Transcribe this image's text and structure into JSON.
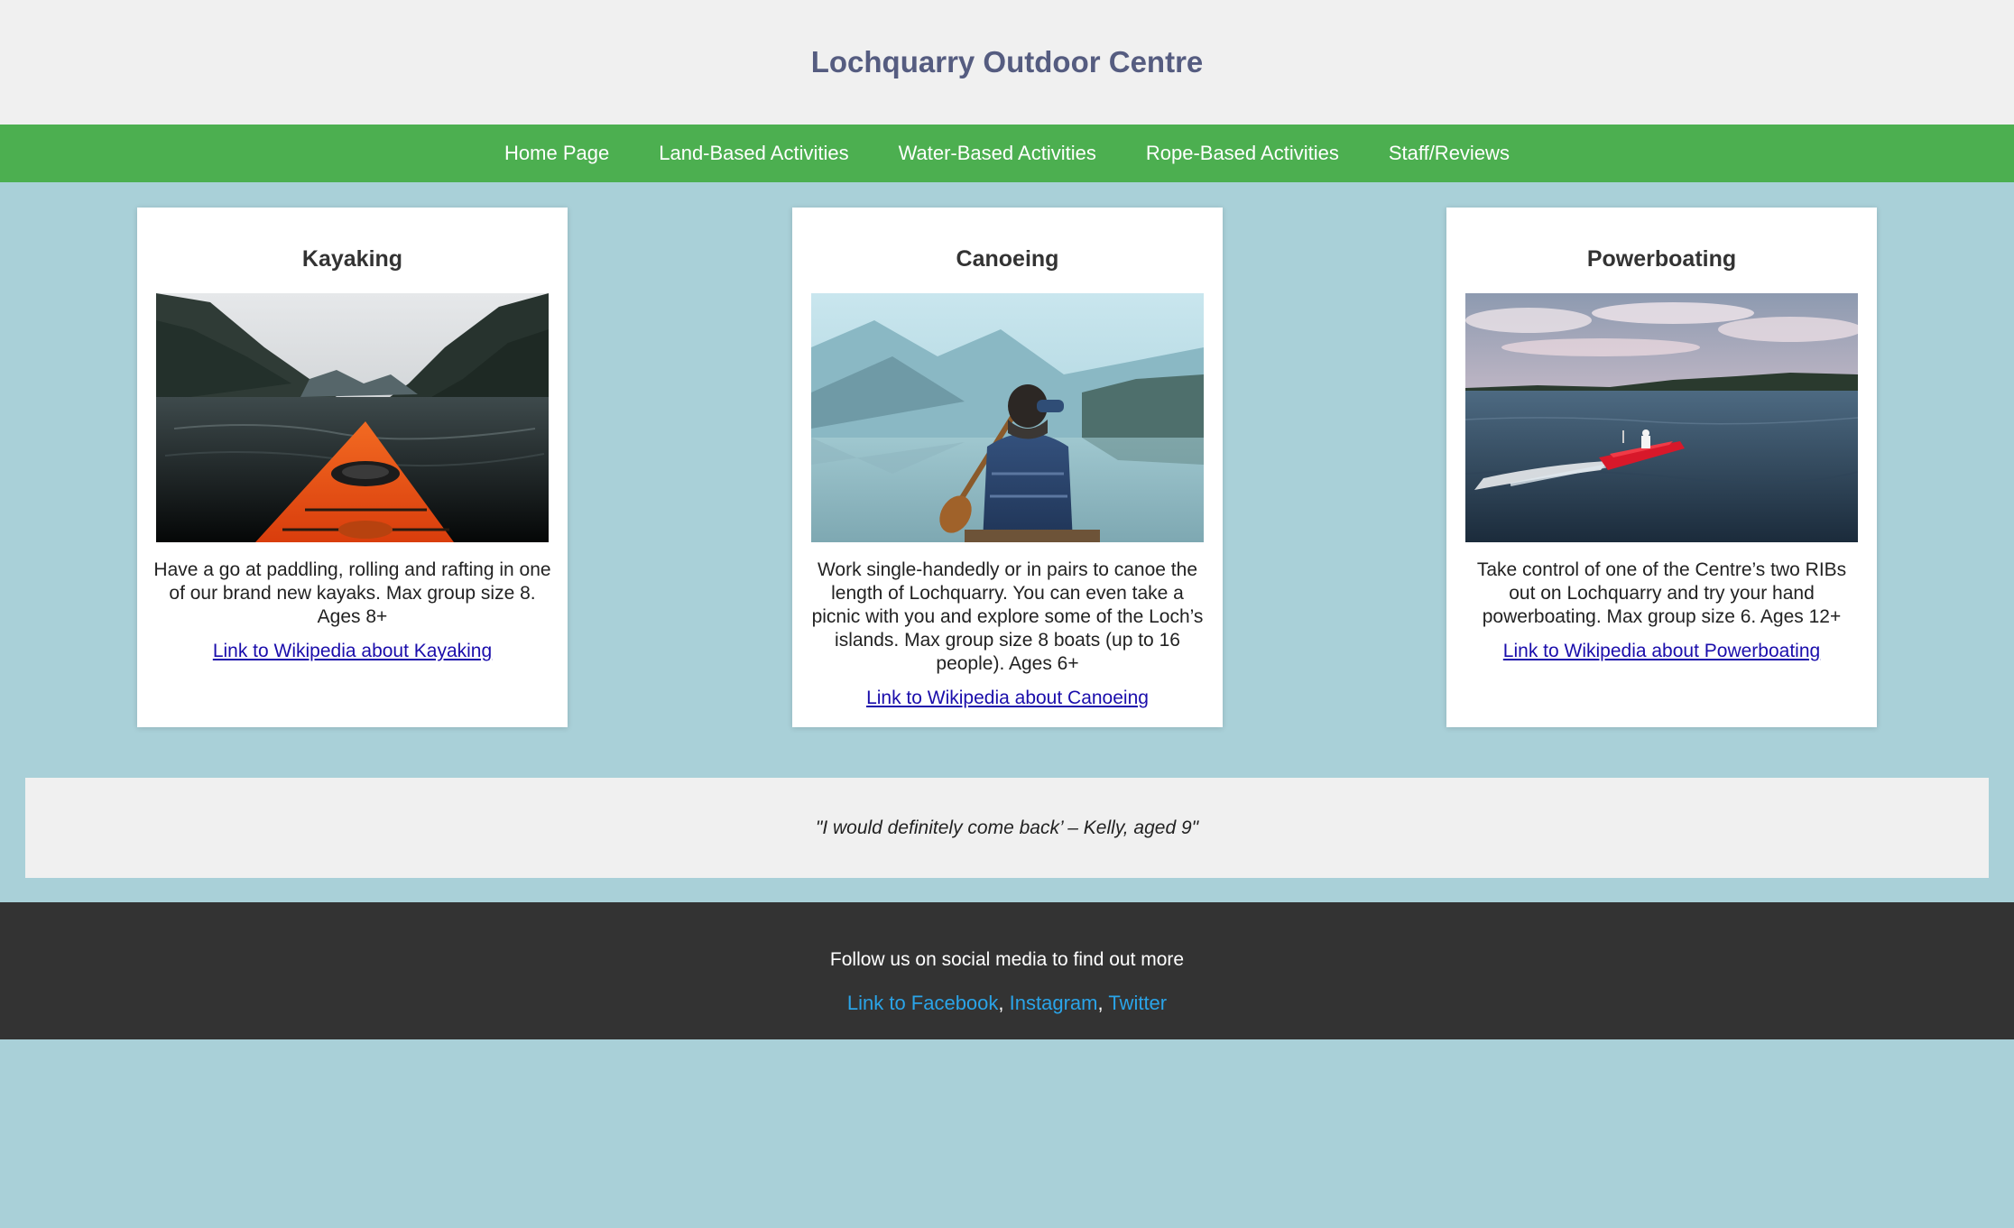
{
  "header": {
    "title": "Lochquarry Outdoor Centre"
  },
  "nav": {
    "items": [
      {
        "label": "Home Page"
      },
      {
        "label": "Land-Based Activities"
      },
      {
        "label": "Water-Based Activities"
      },
      {
        "label": "Rope-Based Activities"
      },
      {
        "label": "Staff/Reviews"
      }
    ]
  },
  "cards": [
    {
      "title": "Kayaking",
      "image": "kayak-photo",
      "text": "Have a go at paddling, rolling and rafting in one of our brand new kayaks. Max group size 8. Ages 8+",
      "link": "Link to Wikipedia about Kayaking"
    },
    {
      "title": "Canoeing",
      "image": "canoe-photo",
      "text": "Work single-handedly or in pairs to canoe the length of Lochquarry. You can even take a picnic with you and explore some of the Loch’s islands. Max group size 8 boats (up to 16 people). Ages 6+",
      "link": "Link to Wikipedia about Canoeing"
    },
    {
      "title": "Powerboating",
      "image": "powerboat-photo",
      "text": "Take control of one of the Centre’s two RIBs out on Lochquarry and try your hand powerboating. Max group size 6. Ages 12+",
      "link": "Link to Wikipedia about Powerboating"
    }
  ],
  "testimonial": {
    "quote": "\"I would definitely come back’ – Kelly, aged 9\""
  },
  "footer": {
    "text": "Follow us on social media to find out more",
    "links": {
      "facebook": "Link to Facebook",
      "instagram": "Instagram",
      "twitter": "Twitter",
      "separator": ","
    }
  },
  "colors": {
    "page_background": "#a9d0d8",
    "header_background": "#f0f0f0",
    "title_color": "#555c80",
    "nav_background": "#4caf50",
    "footer_background": "#333333",
    "social_link_color": "#2aa4e8",
    "card_link_color": "#1a0dab"
  }
}
